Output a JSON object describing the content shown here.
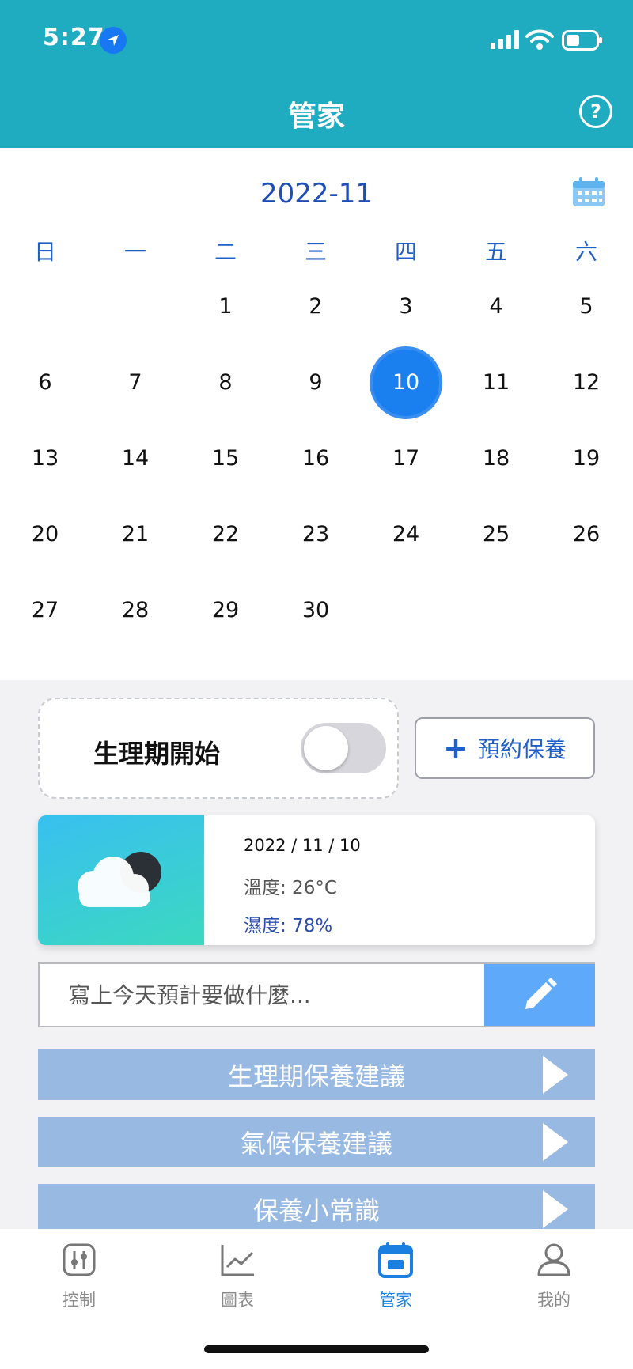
{
  "status": {
    "time": "5:27"
  },
  "header": {
    "title": "管家",
    "help_label": "?"
  },
  "calendar": {
    "month_label": "2022-11",
    "weekdays": [
      "日",
      "一",
      "二",
      "三",
      "四",
      "五",
      "六"
    ],
    "days": [
      "1",
      "2",
      "3",
      "4",
      "5",
      "6",
      "7",
      "8",
      "9",
      "10",
      "11",
      "12",
      "13",
      "14",
      "15",
      "16",
      "17",
      "18",
      "19",
      "20",
      "21",
      "22",
      "23",
      "24",
      "25",
      "26",
      "27",
      "28",
      "29",
      "30"
    ],
    "selected_day": "10"
  },
  "period": {
    "label": "生理期開始",
    "toggle_on": false
  },
  "reserve_button": {
    "label": "預約保養"
  },
  "weather": {
    "date": "2022 / 11 / 10",
    "temperature": "溫度: 26°C",
    "humidity": "濕度: 78%",
    "icon": "cloudy-night-icon"
  },
  "todo": {
    "placeholder": "寫上今天預計要做什麼..."
  },
  "advice": [
    {
      "label": "生理期保養建議"
    },
    {
      "label": "氣候保養建議"
    },
    {
      "label": "保養小常識"
    }
  ],
  "tabs": [
    {
      "label": "控制",
      "icon": "sliders-icon"
    },
    {
      "label": "圖表",
      "icon": "line-chart-icon"
    },
    {
      "label": "管家",
      "icon": "calendar-icon"
    },
    {
      "label": "我的",
      "icon": "user-icon"
    }
  ],
  "active_tab": "管家",
  "colors": {
    "header": "#1fabc0",
    "accent": "#1a80f0",
    "advice_bg": "#98b9e2",
    "edit_btn": "#5fa9fa"
  }
}
